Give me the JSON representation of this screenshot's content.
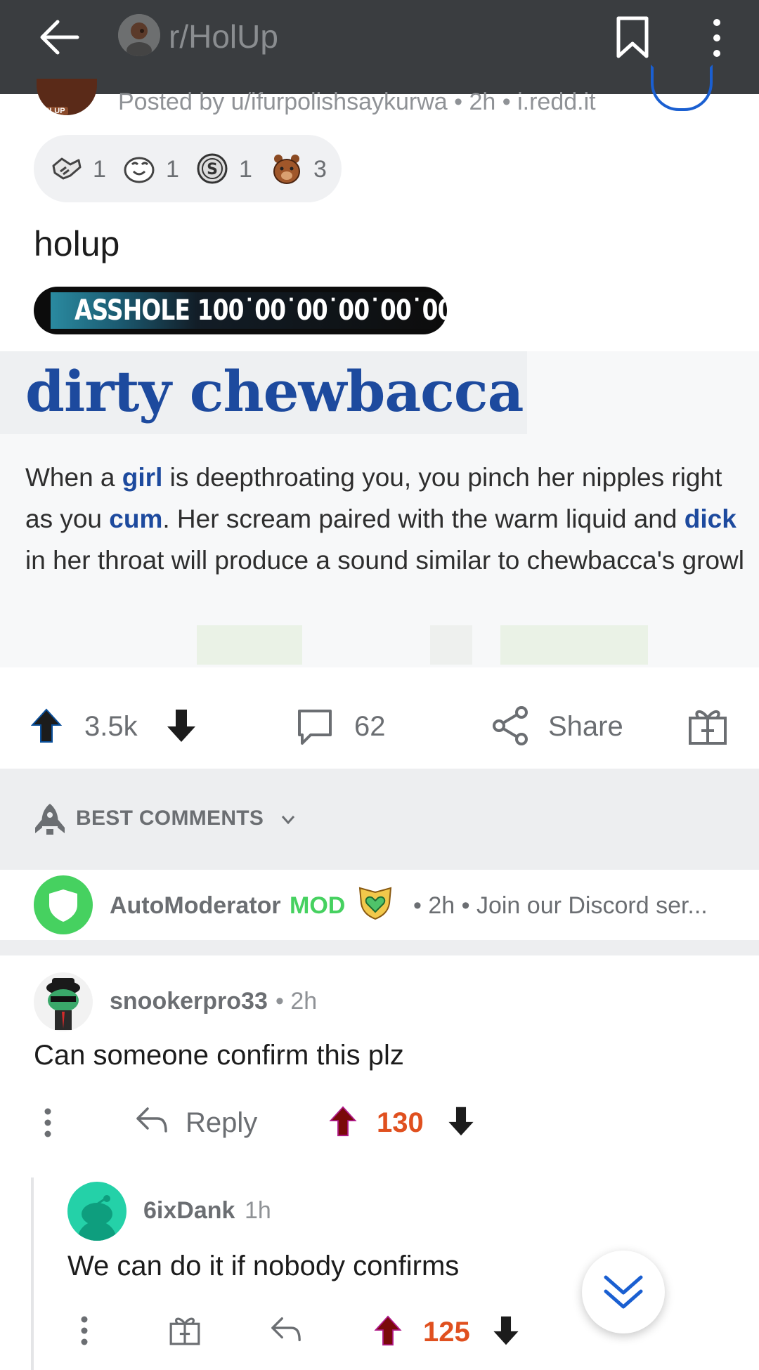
{
  "appbar": {
    "subreddit": "r/HolUp",
    "icons": [
      "back-arrow-icon",
      "subreddit-avatar",
      "bookmark-icon",
      "more-vertical-icon"
    ],
    "color": "#3a3d40"
  },
  "post": {
    "avatar_tag": "OLUP",
    "posted_by": "Posted by u/ifurpolishsaykurwa • 2h • i.redd.it",
    "awards": [
      {
        "icon": "handshake-award-icon",
        "count": "1"
      },
      {
        "icon": "laughing-face-award-icon",
        "count": "1"
      },
      {
        "icon": "silver-coin-award-icon",
        "count": "1"
      },
      {
        "icon": "bear-award-icon",
        "count": "3"
      }
    ],
    "title": "holup",
    "flair": "ASSHOLE 100˙00˙00˙00˙00˙00",
    "image": {
      "word": "dirty chewbacca",
      "definition": [
        {
          "t": "When a ",
          "link": false
        },
        {
          "t": "girl",
          "link": true
        },
        {
          "t": " is deepthroating you, you pinch her nipples right as you ",
          "link": false
        },
        {
          "t": "cum",
          "link": true
        },
        {
          "t": ". Her scream paired with the warm liquid and ",
          "link": false
        },
        {
          "t": "dick",
          "link": true
        },
        {
          "t": " in her throat will produce a sound similar to chewbacca's growl",
          "link": false
        }
      ]
    },
    "actions": {
      "score": "3.5k",
      "comments": "62",
      "share": "Share"
    }
  },
  "sort": {
    "label": "BEST COMMENTS",
    "icon": "rocket-icon"
  },
  "automod": {
    "user": "AutoModerator",
    "badge": "MOD",
    "meta": "• 2h • Join our Discord ser...",
    "color": "#46d160"
  },
  "comments": [
    {
      "user": "snookerpro33",
      "time": "• 2h",
      "body": "Can someone confirm this plz",
      "reply": "Reply",
      "score": "130"
    },
    {
      "user": "6ixDank",
      "time": "1h",
      "body": "We can do it if nobody confirms",
      "score": "125"
    }
  ],
  "colors": {
    "upvote_score": "#e0501f",
    "link_blue": "#1d4a9e",
    "muted": "#6b6e72"
  }
}
